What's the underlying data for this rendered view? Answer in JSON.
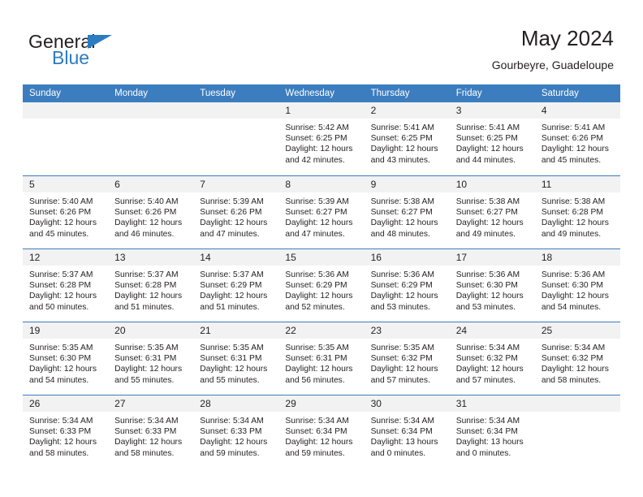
{
  "logo": {
    "word_one": "General",
    "word_two": "Blue",
    "accent_color": "#2b7cc0"
  },
  "header": {
    "title": "May 2024",
    "subtitle": "Gourbeyre, Guadeloupe"
  },
  "theme": {
    "header_row_color": "#3b7dbf",
    "day_strip_color": "#f2f2f2",
    "text_color": "#231f20"
  },
  "weekdays": [
    "Sunday",
    "Monday",
    "Tuesday",
    "Wednesday",
    "Thursday",
    "Friday",
    "Saturday"
  ],
  "weeks": [
    [
      {
        "day": "",
        "empty": true,
        "sunrise": "",
        "sunset": "",
        "daylight_line1": "",
        "daylight_line2": ""
      },
      {
        "day": "",
        "empty": true,
        "sunrise": "",
        "sunset": "",
        "daylight_line1": "",
        "daylight_line2": ""
      },
      {
        "day": "",
        "empty": true,
        "sunrise": "",
        "sunset": "",
        "daylight_line1": "",
        "daylight_line2": ""
      },
      {
        "day": "1",
        "sunrise": "Sunrise: 5:42 AM",
        "sunset": "Sunset: 6:25 PM",
        "daylight_line1": "Daylight: 12 hours",
        "daylight_line2": "and 42 minutes."
      },
      {
        "day": "2",
        "sunrise": "Sunrise: 5:41 AM",
        "sunset": "Sunset: 6:25 PM",
        "daylight_line1": "Daylight: 12 hours",
        "daylight_line2": "and 43 minutes."
      },
      {
        "day": "3",
        "sunrise": "Sunrise: 5:41 AM",
        "sunset": "Sunset: 6:25 PM",
        "daylight_line1": "Daylight: 12 hours",
        "daylight_line2": "and 44 minutes."
      },
      {
        "day": "4",
        "sunrise": "Sunrise: 5:41 AM",
        "sunset": "Sunset: 6:26 PM",
        "daylight_line1": "Daylight: 12 hours",
        "daylight_line2": "and 45 minutes."
      }
    ],
    [
      {
        "day": "5",
        "sunrise": "Sunrise: 5:40 AM",
        "sunset": "Sunset: 6:26 PM",
        "daylight_line1": "Daylight: 12 hours",
        "daylight_line2": "and 45 minutes."
      },
      {
        "day": "6",
        "sunrise": "Sunrise: 5:40 AM",
        "sunset": "Sunset: 6:26 PM",
        "daylight_line1": "Daylight: 12 hours",
        "daylight_line2": "and 46 minutes."
      },
      {
        "day": "7",
        "sunrise": "Sunrise: 5:39 AM",
        "sunset": "Sunset: 6:26 PM",
        "daylight_line1": "Daylight: 12 hours",
        "daylight_line2": "and 47 minutes."
      },
      {
        "day": "8",
        "sunrise": "Sunrise: 5:39 AM",
        "sunset": "Sunset: 6:27 PM",
        "daylight_line1": "Daylight: 12 hours",
        "daylight_line2": "and 47 minutes."
      },
      {
        "day": "9",
        "sunrise": "Sunrise: 5:38 AM",
        "sunset": "Sunset: 6:27 PM",
        "daylight_line1": "Daylight: 12 hours",
        "daylight_line2": "and 48 minutes."
      },
      {
        "day": "10",
        "sunrise": "Sunrise: 5:38 AM",
        "sunset": "Sunset: 6:27 PM",
        "daylight_line1": "Daylight: 12 hours",
        "daylight_line2": "and 49 minutes."
      },
      {
        "day": "11",
        "sunrise": "Sunrise: 5:38 AM",
        "sunset": "Sunset: 6:28 PM",
        "daylight_line1": "Daylight: 12 hours",
        "daylight_line2": "and 49 minutes."
      }
    ],
    [
      {
        "day": "12",
        "sunrise": "Sunrise: 5:37 AM",
        "sunset": "Sunset: 6:28 PM",
        "daylight_line1": "Daylight: 12 hours",
        "daylight_line2": "and 50 minutes."
      },
      {
        "day": "13",
        "sunrise": "Sunrise: 5:37 AM",
        "sunset": "Sunset: 6:28 PM",
        "daylight_line1": "Daylight: 12 hours",
        "daylight_line2": "and 51 minutes."
      },
      {
        "day": "14",
        "sunrise": "Sunrise: 5:37 AM",
        "sunset": "Sunset: 6:29 PM",
        "daylight_line1": "Daylight: 12 hours",
        "daylight_line2": "and 51 minutes."
      },
      {
        "day": "15",
        "sunrise": "Sunrise: 5:36 AM",
        "sunset": "Sunset: 6:29 PM",
        "daylight_line1": "Daylight: 12 hours",
        "daylight_line2": "and 52 minutes."
      },
      {
        "day": "16",
        "sunrise": "Sunrise: 5:36 AM",
        "sunset": "Sunset: 6:29 PM",
        "daylight_line1": "Daylight: 12 hours",
        "daylight_line2": "and 53 minutes."
      },
      {
        "day": "17",
        "sunrise": "Sunrise: 5:36 AM",
        "sunset": "Sunset: 6:30 PM",
        "daylight_line1": "Daylight: 12 hours",
        "daylight_line2": "and 53 minutes."
      },
      {
        "day": "18",
        "sunrise": "Sunrise: 5:36 AM",
        "sunset": "Sunset: 6:30 PM",
        "daylight_line1": "Daylight: 12 hours",
        "daylight_line2": "and 54 minutes."
      }
    ],
    [
      {
        "day": "19",
        "sunrise": "Sunrise: 5:35 AM",
        "sunset": "Sunset: 6:30 PM",
        "daylight_line1": "Daylight: 12 hours",
        "daylight_line2": "and 54 minutes."
      },
      {
        "day": "20",
        "sunrise": "Sunrise: 5:35 AM",
        "sunset": "Sunset: 6:31 PM",
        "daylight_line1": "Daylight: 12 hours",
        "daylight_line2": "and 55 minutes."
      },
      {
        "day": "21",
        "sunrise": "Sunrise: 5:35 AM",
        "sunset": "Sunset: 6:31 PM",
        "daylight_line1": "Daylight: 12 hours",
        "daylight_line2": "and 55 minutes."
      },
      {
        "day": "22",
        "sunrise": "Sunrise: 5:35 AM",
        "sunset": "Sunset: 6:31 PM",
        "daylight_line1": "Daylight: 12 hours",
        "daylight_line2": "and 56 minutes."
      },
      {
        "day": "23",
        "sunrise": "Sunrise: 5:35 AM",
        "sunset": "Sunset: 6:32 PM",
        "daylight_line1": "Daylight: 12 hours",
        "daylight_line2": "and 57 minutes."
      },
      {
        "day": "24",
        "sunrise": "Sunrise: 5:34 AM",
        "sunset": "Sunset: 6:32 PM",
        "daylight_line1": "Daylight: 12 hours",
        "daylight_line2": "and 57 minutes."
      },
      {
        "day": "25",
        "sunrise": "Sunrise: 5:34 AM",
        "sunset": "Sunset: 6:32 PM",
        "daylight_line1": "Daylight: 12 hours",
        "daylight_line2": "and 58 minutes."
      }
    ],
    [
      {
        "day": "26",
        "sunrise": "Sunrise: 5:34 AM",
        "sunset": "Sunset: 6:33 PM",
        "daylight_line1": "Daylight: 12 hours",
        "daylight_line2": "and 58 minutes."
      },
      {
        "day": "27",
        "sunrise": "Sunrise: 5:34 AM",
        "sunset": "Sunset: 6:33 PM",
        "daylight_line1": "Daylight: 12 hours",
        "daylight_line2": "and 58 minutes."
      },
      {
        "day": "28",
        "sunrise": "Sunrise: 5:34 AM",
        "sunset": "Sunset: 6:33 PM",
        "daylight_line1": "Daylight: 12 hours",
        "daylight_line2": "and 59 minutes."
      },
      {
        "day": "29",
        "sunrise": "Sunrise: 5:34 AM",
        "sunset": "Sunset: 6:34 PM",
        "daylight_line1": "Daylight: 12 hours",
        "daylight_line2": "and 59 minutes."
      },
      {
        "day": "30",
        "sunrise": "Sunrise: 5:34 AM",
        "sunset": "Sunset: 6:34 PM",
        "daylight_line1": "Daylight: 13 hours",
        "daylight_line2": "and 0 minutes."
      },
      {
        "day": "31",
        "sunrise": "Sunrise: 5:34 AM",
        "sunset": "Sunset: 6:34 PM",
        "daylight_line1": "Daylight: 13 hours",
        "daylight_line2": "and 0 minutes."
      },
      {
        "day": "",
        "empty": true,
        "sunrise": "",
        "sunset": "",
        "daylight_line1": "",
        "daylight_line2": ""
      }
    ]
  ]
}
